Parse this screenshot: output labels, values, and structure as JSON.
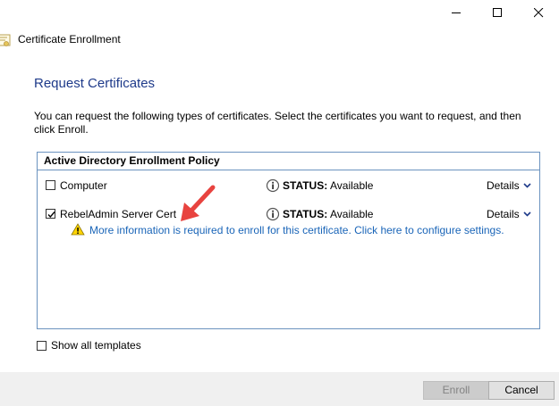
{
  "window": {
    "title": "Certificate Enrollment"
  },
  "page": {
    "title": "Request Certificates",
    "intro": "You can request the following types of certificates. Select the certificates you want to request, and then click Enroll."
  },
  "policy": {
    "header": "Active Directory Enrollment Policy",
    "certificates": [
      {
        "name": "Computer",
        "checked": false,
        "status_label": "STATUS:",
        "status_value": "Available",
        "details_label": "Details"
      },
      {
        "name": "RebelAdmin Server Cert",
        "checked": true,
        "status_label": "STATUS:",
        "status_value": "Available",
        "details_label": "Details",
        "warning": "More information is required to enroll for this certificate. Click here to configure settings."
      }
    ]
  },
  "options": {
    "show_all_templates": "Show all templates"
  },
  "buttons": {
    "enroll": "Enroll",
    "cancel": "Cancel"
  },
  "icons": {
    "minimize": "minimize-icon",
    "maximize": "maximize-icon",
    "close": "close-icon",
    "certificate": "certificate-icon",
    "info": "info-icon",
    "warning": "warning-icon",
    "chevron": "chevron-down-icon",
    "annotation": "red-arrow-annotation"
  },
  "colors": {
    "title_blue": "#1e3a8a",
    "link_blue": "#1a65b8",
    "border_blue": "#6b93bf",
    "arrow_red": "#e8433f"
  }
}
